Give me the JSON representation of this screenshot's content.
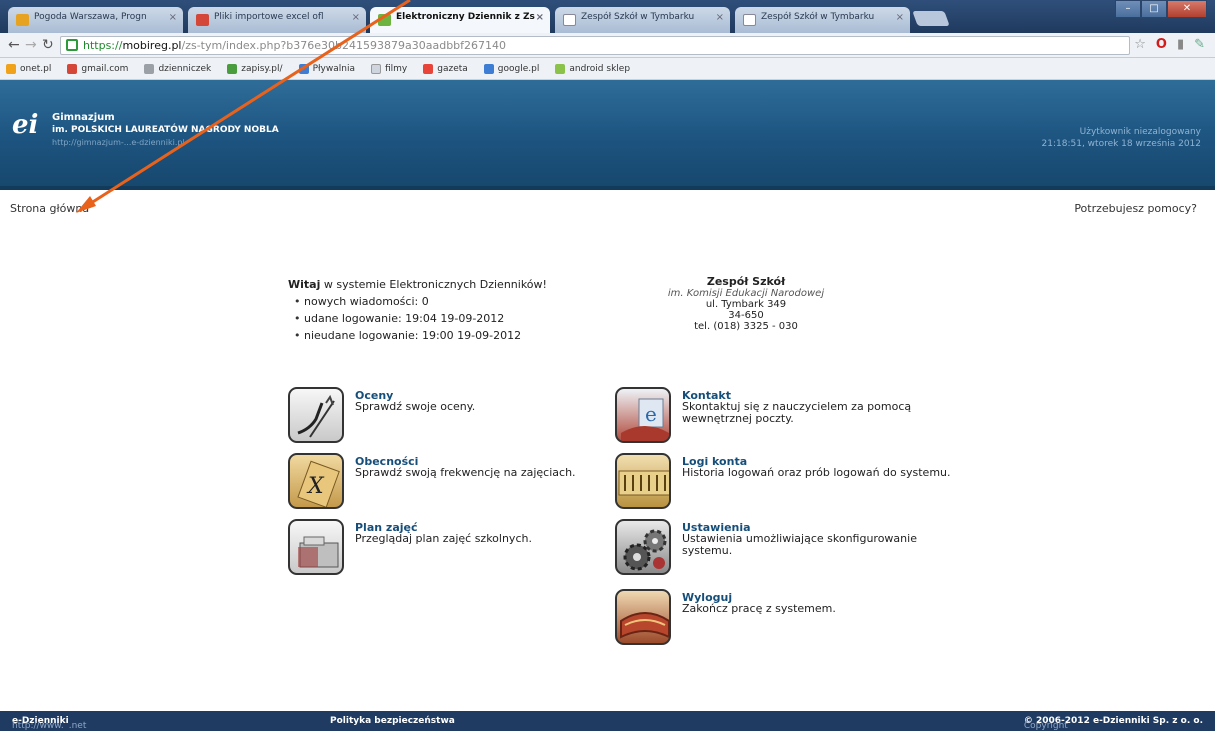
{
  "browser": {
    "tabs": [
      {
        "label": "Pogoda Warszawa, Progn",
        "color": "#e6a321"
      },
      {
        "label": "Pliki importowe excel ofl",
        "color": "#d44638"
      },
      {
        "label": "Elektroniczny Dziennik z Zs",
        "color": "#6cb33f"
      },
      {
        "label": "Zespół Szkół w Tymbarku",
        "color": "#ffffff"
      },
      {
        "label": "Zespół Szkół w Tymbarku",
        "color": "#ffffff"
      }
    ],
    "close_glyph": "×",
    "url_scheme": "https://",
    "url_host": "mobireg.pl",
    "url_path": "/zs-tym/index.php?b376e30b241593879a30aadbbf267140",
    "bookmarks": [
      {
        "label": "onet.pl",
        "color": "#f0a21a"
      },
      {
        "label": "gmail.com",
        "color": "#d44638"
      },
      {
        "label": "dzienniczek",
        "color": "#9aa0a6"
      },
      {
        "label": "zapisy.pl/",
        "color": "#4a9d3c"
      },
      {
        "label": "Pływalnia",
        "color": "#3d7dd4"
      },
      {
        "label": "filmy",
        "color": "#cfd5de"
      },
      {
        "label": "gazeta",
        "color": "#e8443a"
      },
      {
        "label": "google.pl",
        "color": "#3d7dd4"
      },
      {
        "label": "android sklep",
        "color": "#8bc34a"
      }
    ]
  },
  "header": {
    "logo": "ei",
    "school_line1": "Gimnazjum",
    "school_line2": "im. POLSKICH LAUREATÓW NAGRODY NOBLA",
    "school_line3": "http://gimnazjum-...e-dzienniki.pl",
    "user_line1": "Użytkownik niezalogowany",
    "user_line2": "21:18:51, wtorek 18 września 2012"
  },
  "nav": {
    "home": "Strona główna",
    "help": "Potrzebujesz pomocy?"
  },
  "welcome": {
    "bold": "Witaj",
    "rest": " w systemie Elektronicznych Dzienników!",
    "items": [
      "nowych wiadomości: 0",
      "udane logowanie: 19:04 19-09-2012",
      "nieudane logowanie: 19:00 19-09-2012"
    ]
  },
  "address": {
    "name": "Zespół Szkół",
    "patron": "im. Komisji Edukacji Narodowej",
    "street": "ul. Tymbark 349",
    "postal": "34-650",
    "phone": "tel. (018) 3325 - 030"
  },
  "modules": {
    "oceny": {
      "title": "Oceny",
      "desc": "Sprawdź swoje oceny."
    },
    "obecnosci": {
      "title": "Obecności",
      "desc": "Sprawdź swoją frekwencję na zajęciach."
    },
    "plan": {
      "title": "Plan zajęć",
      "desc": "Przeglądaj plan zajęć szkolnych."
    },
    "kontakt": {
      "title": "Kontakt",
      "desc": "Skontaktuj się z nauczycielem za pomocą wewnętrznej poczty."
    },
    "logi": {
      "title": "Logi konta",
      "desc": "Historia logowań oraz prób logowań do systemu."
    },
    "ustawienia": {
      "title": "Ustawienia",
      "desc": "Ustawienia umożliwiające skonfigurowanie systemu."
    },
    "wyloguj": {
      "title": "Wyloguj",
      "desc": "Zakończ pracę z systemem."
    }
  },
  "footer": {
    "link_prefix": "http://www.",
    "link_bold": "e-Dzienniki",
    "link_suffix": ".net",
    "policy": "Polityka bezpieczeństwa",
    "copyright_prefix": "Copyright ",
    "copyright_bold": "© 2006-2012 e-Dzienniki Sp. z o. o."
  },
  "annotation_color": "#e8621c"
}
